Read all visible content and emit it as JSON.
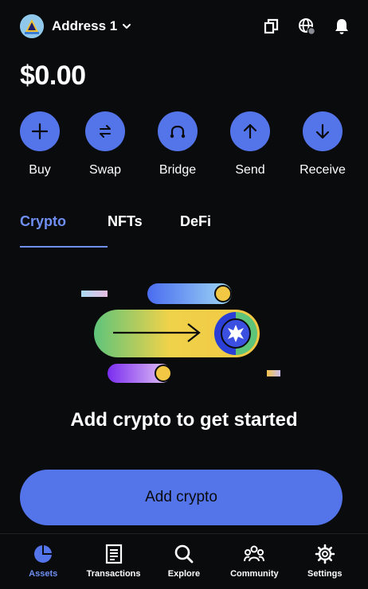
{
  "header": {
    "account_name": "Address 1",
    "icons": [
      "copy-icon",
      "globe-icon",
      "bell-icon"
    ]
  },
  "balance": "$0.00",
  "actions": [
    {
      "label": "Buy",
      "icon": "plus-icon"
    },
    {
      "label": "Swap",
      "icon": "swap-icon"
    },
    {
      "label": "Bridge",
      "icon": "bridge-icon"
    },
    {
      "label": "Send",
      "icon": "arrow-up-icon"
    },
    {
      "label": "Receive",
      "icon": "arrow-down-icon"
    }
  ],
  "tabs": [
    {
      "label": "Crypto",
      "active": true
    },
    {
      "label": "NFTs",
      "active": false
    },
    {
      "label": "DeFi",
      "active": false
    }
  ],
  "empty_state": {
    "title": "Add crypto to get started",
    "button_label": "Add crypto"
  },
  "nav": [
    {
      "label": "Assets",
      "icon": "pie-chart-icon",
      "active": true
    },
    {
      "label": "Transactions",
      "icon": "receipt-icon",
      "active": false
    },
    {
      "label": "Explore",
      "icon": "search-icon",
      "active": false
    },
    {
      "label": "Community",
      "icon": "community-icon",
      "active": false
    },
    {
      "label": "Settings",
      "icon": "gear-icon",
      "active": false
    }
  ],
  "colors": {
    "background": "#0a0b0d",
    "accent": "#5474e9",
    "active_tab": "#6f8ff2"
  }
}
